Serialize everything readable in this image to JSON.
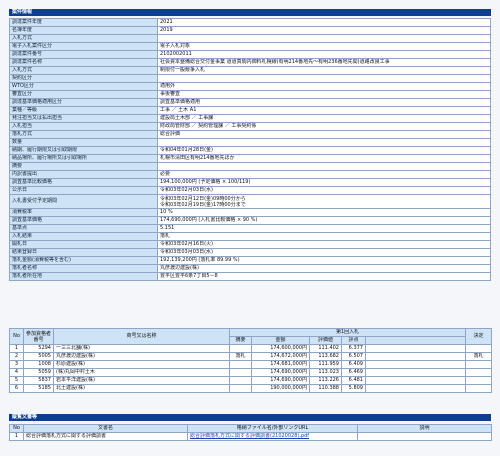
{
  "header": {
    "title": "案件情報"
  },
  "info_rows": [
    {
      "key": "調達案件年度",
      "value": "2021"
    },
    {
      "key": "名簿年度",
      "value": "2019"
    },
    {
      "key": "入札方式",
      "value": ""
    },
    {
      "key": "電子入札案件区分",
      "value": "電子入札対象"
    },
    {
      "key": "調達案件番号",
      "value": "2102002011"
    },
    {
      "key": "調達案件名称",
      "value": "社会資本整備総合交付金事業 道道真駒内御料札幌線(有明214番地先～有明236番地先間)道路改良工事"
    },
    {
      "key": "入札方式",
      "value": "制限付一般競争入札"
    },
    {
      "key": "契約区分",
      "value": ""
    },
    {
      "key": "WTO区分",
      "value": "適用外"
    },
    {
      "key": "審査区分",
      "value": "事後審査"
    },
    {
      "key": "調達基準価格適用区分",
      "value": "調査基準価格適用"
    },
    {
      "key": "業種／等級",
      "value": "工事 ／ 土木 A1"
    },
    {
      "key": "発注担当又は払出担当",
      "value": "建設局土木部 ／ 工事課"
    },
    {
      "key": "入札担当",
      "value": "財政局管財部 ／ 契約管理課 ／ 工事契約係"
    },
    {
      "key": "落札方式",
      "value": "総合評価"
    },
    {
      "key": "数量",
      "value": ""
    },
    {
      "key": "納期、履行期限又は引取期限",
      "value": "令和04年01月28日(金)"
    },
    {
      "key": "納品場所、履行場所又は引取場所",
      "value": "札幌市清田区有明214番地先ほか"
    },
    {
      "key": "摘要",
      "value": ""
    },
    {
      "key": "内訳書提出",
      "value": "必要"
    },
    {
      "key": "調査基準比較価格",
      "value": "194,100,000円 (予定価格 × 100/119)"
    },
    {
      "key": "公示日",
      "value": "令和03年02月03日(水)"
    },
    {
      "key": "入札書受付予定期間",
      "value": "令和03年02月12日(金)09時00分から\n令和03年02月19日(金)17時00分まで"
    },
    {
      "key": "消費税率",
      "value": "10 %"
    },
    {
      "key": "調査基準価格",
      "value": "174,690,000円 (入札書比較価格 × 90 %)"
    },
    {
      "key": "基準点",
      "value": "5.151"
    },
    {
      "key": "入札結果",
      "value": "落札"
    },
    {
      "key": "開札日",
      "value": "令和03年02月16日(火)"
    },
    {
      "key": "結果登録日",
      "value": "令和03年03月03日(水)"
    },
    {
      "key": "落札金額(消費税等を含む)",
      "value": "192,139,200円 (落札率 89.99 %)"
    },
    {
      "key": "落札者名称",
      "value": "丸彦渡辺建設(株)"
    },
    {
      "key": "落札者所在地",
      "value": "豊平区豊平6条7丁目5－8"
    }
  ],
  "results": {
    "headers": {
      "no": "No",
      "bidder_no": "参加資格者番号",
      "name": "商号又は名称",
      "round": "第1回入札",
      "decision": "決定",
      "remark": "摘要",
      "amount": "金額",
      "eval": "評価値",
      "score": "評点"
    },
    "rows": [
      {
        "no": "1",
        "bidder": "5294",
        "name": "一三三北舗(株)",
        "remark": "",
        "amount": "174,600,000円",
        "eval": "111.402",
        "score": "6.377",
        "decision": ""
      },
      {
        "no": "2",
        "bidder": "5005",
        "name": "丸彦渡辺建設(株)",
        "remark": "落札",
        "amount": "174,672,000円",
        "eval": "113.682",
        "score": "6.507",
        "decision": "落札"
      },
      {
        "no": "3",
        "bidder": "1008",
        "name": "杉原建設(株)",
        "remark": "",
        "amount": "174,681,000円",
        "eval": "111.959",
        "score": "6.409",
        "decision": ""
      },
      {
        "no": "4",
        "bidder": "5059",
        "name": "(株)丸岡中村土木",
        "remark": "",
        "amount": "174,690,000円",
        "eval": "113.023",
        "score": "6.469",
        "decision": ""
      },
      {
        "no": "5",
        "bidder": "5837",
        "name": "岩本平洋建設(株)",
        "remark": "",
        "amount": "174,690,000円",
        "eval": "113.226",
        "score": "6.481",
        "decision": ""
      },
      {
        "no": "6",
        "bidder": "5185",
        "name": "北土建設(株)",
        "remark": "",
        "amount": "190,000,000円",
        "eval": "110.388",
        "score": "5.809",
        "decision": ""
      }
    ]
  },
  "docs": {
    "title": "縦覧文書等",
    "headers": {
      "no": "No",
      "name": "文書名",
      "link": "格納ファイル名/外部リンクURL",
      "note": "説明"
    },
    "rows": [
      {
        "no": "1",
        "name": "総合評価落札方式に関する評価調書",
        "link": "総合評価落札方式に関する評価調書(21020028).pdf",
        "note": ""
      }
    ]
  }
}
